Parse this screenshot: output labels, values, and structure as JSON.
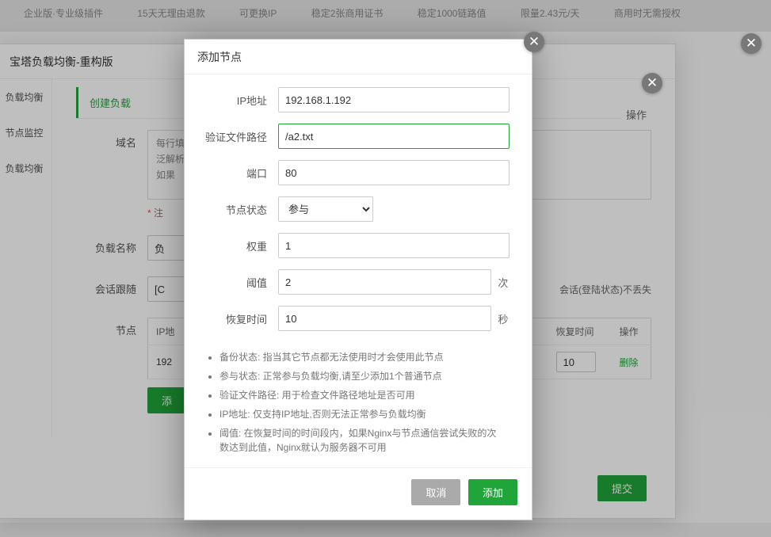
{
  "bg": {
    "chips": [
      "企业版·专业级插件",
      "15天无理由退款",
      "可更换IP",
      "稳定2张商用证书",
      "稳定1000链路值",
      "限量2.43元/天",
      "商用时无需授权"
    ]
  },
  "dlg1": {
    "title": "宝塔负载均衡-重构版",
    "sidebar": [
      "负载均衡",
      "节点监控",
      "负载均衡"
    ],
    "tab_active": "创建负载",
    "op_header": "操作",
    "domain_label": "域名",
    "domain_hint1": "每行填写一个域名",
    "domain_hint2": "泛解析添加",
    "domain_hint3": "如果",
    "domain_note_star": "* 注",
    "name_label": "负载名称",
    "name_value": "负",
    "session_label": "会话跟随",
    "session_value": "[C",
    "session_after": "会话(登陆状态)不丢失",
    "node_label": "节点",
    "tbl": {
      "col_ip": "IP地",
      "col_recover": "恢复时间",
      "col_op": "操作",
      "row_ip": "192",
      "row_recover": "10",
      "row_del": "删除"
    },
    "add_btn": "添",
    "submit_btn": "提交"
  },
  "dlg2": {
    "title": "添加节点",
    "ip_label": "IP地址",
    "ip_value": "192.168.1.192",
    "path_label": "验证文件路径",
    "path_value": "/a2.txt",
    "port_label": "端口",
    "port_value": "80",
    "status_label": "节点状态",
    "status_value": "参与",
    "weight_label": "权重",
    "weight_value": "1",
    "threshold_label": "阈值",
    "threshold_value": "2",
    "threshold_unit": "次",
    "recover_label": "恢复时间",
    "recover_value": "10",
    "recover_unit": "秒",
    "tips": [
      "备份状态: 指当其它节点都无法使用时才会使用此节点",
      "参与状态: 正常参与负载均衡,请至少添加1个普通节点",
      "验证文件路径: 用于检查文件路径地址是否可用",
      "IP地址: 仅支持IP地址,否则无法正常参与负载均衡",
      "阈值: 在恢复时间的时间段内，如果Nginx与节点通信尝试失败的次数达到此值，Nginx就认为服务器不可用"
    ],
    "cancel": "取消",
    "confirm": "添加"
  }
}
